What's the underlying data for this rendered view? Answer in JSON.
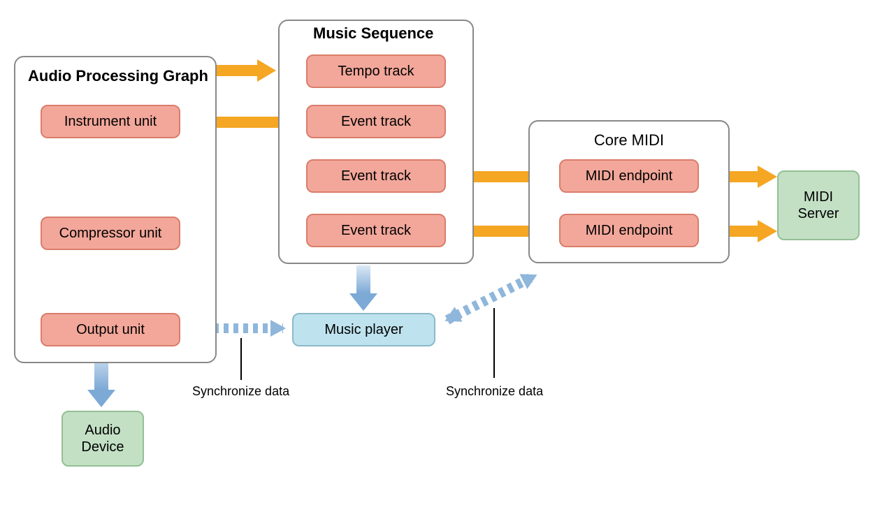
{
  "groups": {
    "audio_processing_graph": {
      "title": "Audio Processing Graph"
    },
    "music_sequence": {
      "title": "Music Sequence"
    },
    "core_midi": {
      "title": "Core MIDI"
    }
  },
  "nodes": {
    "instrument_unit": "Instrument unit",
    "compressor_unit": "Compressor unit",
    "output_unit": "Output unit",
    "tempo_track": "Tempo track",
    "event_track_1": "Event track",
    "event_track_2": "Event track",
    "event_track_3": "Event track",
    "midi_endpoint_1": "MIDI endpoint",
    "midi_endpoint_2": "MIDI endpoint",
    "music_player": "Music player",
    "audio_device": "Audio\nDevice",
    "midi_server": "MIDI\nServer"
  },
  "captions": {
    "sync_left": "Synchronize data",
    "sync_right": "Synchronize data"
  },
  "colors": {
    "orange": "#f5a623",
    "blue": "#7ca9d6",
    "blue_light": "#cde0ef"
  }
}
